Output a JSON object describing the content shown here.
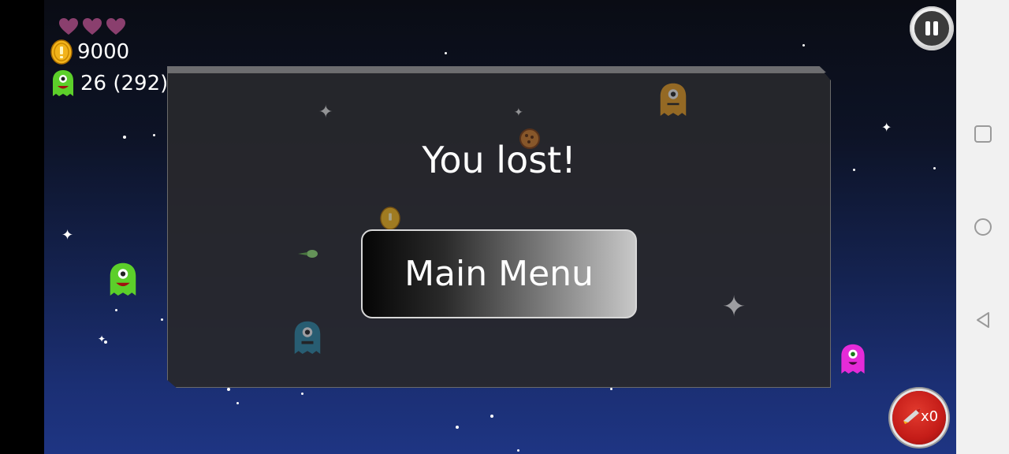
{
  "hud": {
    "lives": 3,
    "coins": "9000",
    "monsters": "26 (292)"
  },
  "dialog": {
    "title": "You lost!",
    "main_menu_label": "Main Menu"
  },
  "bomb": {
    "count": "x0"
  },
  "icons": {
    "heart": "heart-icon",
    "coin": "coin-icon",
    "monster": "green-monster-icon",
    "pause": "pause-icon",
    "rocket": "rocket-icon"
  },
  "colors": {
    "heart": "#8a3f6e",
    "coin": "#f2b31a",
    "green_monster": "#5ccf2a",
    "pink_monster": "#e52bd8",
    "orange_monster": "#f0a020",
    "teal_monster": "#2a8aa8",
    "bomb_button": "#c41c18"
  },
  "nav": {
    "recents": "recents-icon",
    "home": "home-icon",
    "back": "back-icon"
  }
}
